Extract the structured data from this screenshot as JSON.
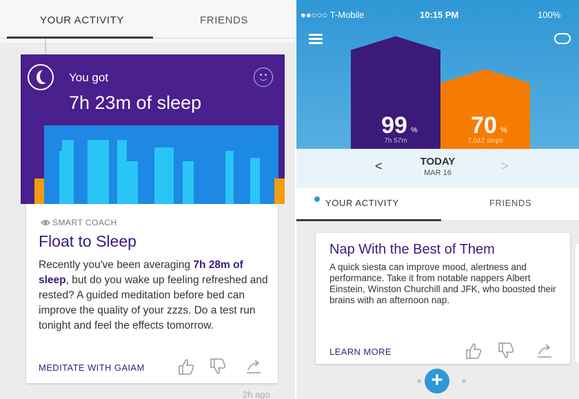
{
  "left": {
    "tabs": [
      {
        "label": "YOUR ACTIVITY"
      },
      {
        "label": "FRIENDS"
      }
    ],
    "sleep_card": {
      "intro": "You got",
      "total": "7h 23m of sleep",
      "colors": {
        "background": "#4a1f8e",
        "deep": "#1e88e5",
        "light": "#29c5f6",
        "awake": "#f39c12"
      }
    },
    "coach_card": {
      "label": "SMART COACH",
      "title": "Float to Sleep",
      "body_before": "Recently you've been averaging ",
      "body_bold": "7h 28m of sleep",
      "body_after": ", but do you wake up feeling refreshed and rested? A guided meditation before bed can improve the quality of your zzzs. Do a test run tonight and feel the effects tomorrow.",
      "action": "MEDITATE WITH GAIAM"
    },
    "time_ago": "2h ago"
  },
  "right": {
    "status_bar": {
      "carrier": "●●○○○ T-Mobile",
      "time": "10:15 PM",
      "battery": "100%"
    },
    "goals": {
      "sleep": {
        "value": "99",
        "unit": "%",
        "detail": "7h 57m",
        "color": "#3b1a7a",
        "percent": 99
      },
      "steps": {
        "value": "70",
        "unit": "%",
        "detail": "7,042 steps",
        "color": "#f57c00",
        "percent": 70
      }
    },
    "day_nav": {
      "title": "TODAY",
      "date": "MAR 16"
    },
    "tabs": [
      {
        "label": "YOUR ACTIVITY"
      },
      {
        "label": "FRIENDS"
      }
    ],
    "card": {
      "title": "Nap With the Best of Them",
      "body": "A quick siesta can improve mood, alertness and performance. Take it from notable nappers Albert Einstein, Winston Churchill and JFK, who boosted their brains with an afternoon nap.",
      "action": "LEARN MORE"
    },
    "add_button_label": "+"
  }
}
